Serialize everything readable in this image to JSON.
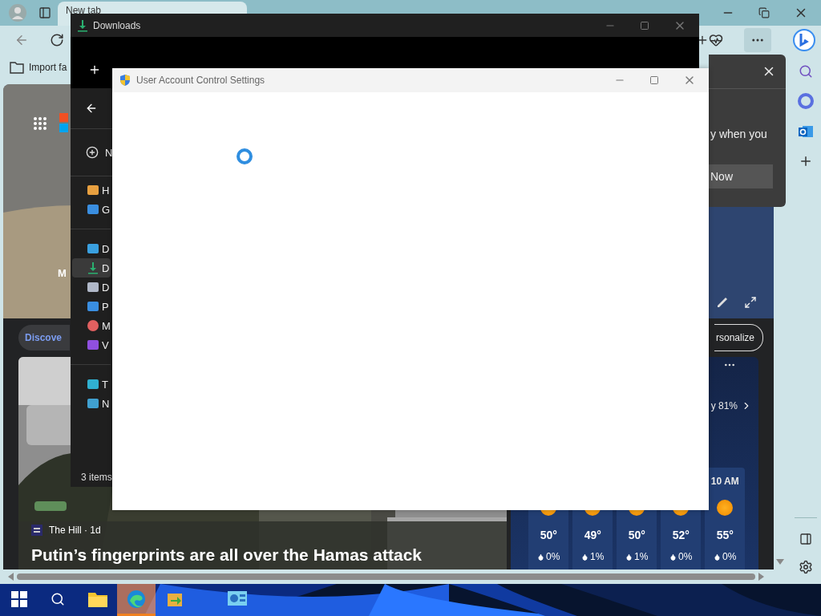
{
  "browser": {
    "tabs": [
      {
        "title": "New tab",
        "selected": true
      }
    ],
    "favorites": [
      {
        "label": "Import fa"
      }
    ],
    "hero": {
      "partial_text": "M"
    },
    "feed": {
      "tabs": [
        {
          "label": "Discove",
          "selected": true
        }
      ],
      "personalize": "rsonalize",
      "news": {
        "source": "The Hill · 1d",
        "headline": "Putin’s fingerprints are all over the Hamas attack"
      },
      "weather": {
        "summary": "y 81%",
        "hourly": [
          {
            "temp": "50°",
            "precip": "0%"
          },
          {
            "temp": "49°",
            "precip": "1%"
          },
          {
            "temp": "50°",
            "precip": "1%"
          },
          {
            "temp": "52°",
            "precip": "0%"
          },
          {
            "time": "10 AM",
            "temp": "55°",
            "precip": "0%"
          }
        ]
      }
    },
    "popup": {
      "text": "y when you",
      "button": "Now"
    }
  },
  "explorer": {
    "title": "Downloads",
    "new_label": "N",
    "nav_groups": [
      [
        {
          "kind": "home",
          "label": "H",
          "selected": false
        },
        {
          "kind": "gallery",
          "label": "G",
          "selected": false
        }
      ],
      [
        {
          "kind": "desktop",
          "label": "D",
          "selected": false
        },
        {
          "kind": "downloads",
          "label": "D",
          "selected": true
        },
        {
          "kind": "documents",
          "label": "D",
          "selected": false
        },
        {
          "kind": "pictures",
          "label": "P",
          "selected": false
        },
        {
          "kind": "music",
          "label": "M",
          "selected": false
        },
        {
          "kind": "videos",
          "label": "V",
          "selected": false
        }
      ],
      [
        {
          "kind": "pc",
          "label": "T",
          "selected": false
        },
        {
          "kind": "network",
          "label": "N",
          "selected": false
        }
      ]
    ],
    "status": "3 items"
  },
  "uac": {
    "title": "User Account Control Settings"
  },
  "taskbar": {
    "apps": [
      {
        "kind": "explorer",
        "selected": false
      },
      {
        "kind": "edge",
        "selected": true
      },
      {
        "kind": "tool",
        "selected": false
      },
      {
        "kind": "control",
        "selected": false
      }
    ]
  }
}
